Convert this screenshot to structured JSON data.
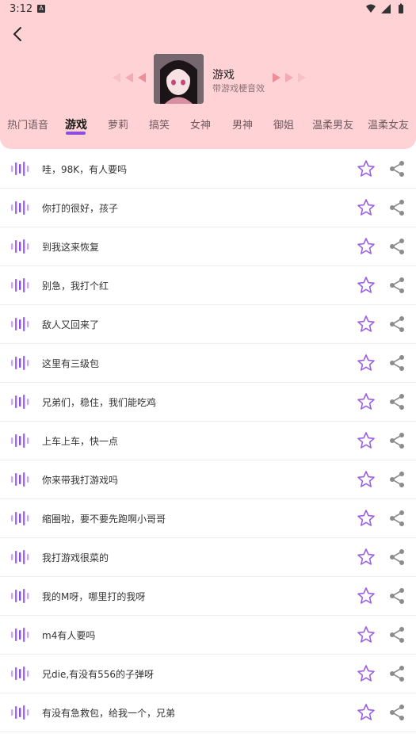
{
  "status": {
    "time": "3:12"
  },
  "category": {
    "title": "游戏",
    "subtitle": "带游戏梗音效"
  },
  "tabs": [
    {
      "label": "热门语音",
      "active": false
    },
    {
      "label": "游戏",
      "active": true
    },
    {
      "label": "萝莉",
      "active": false
    },
    {
      "label": "搞笑",
      "active": false
    },
    {
      "label": "女神",
      "active": false
    },
    {
      "label": "男神",
      "active": false
    },
    {
      "label": "御姐",
      "active": false
    },
    {
      "label": "温柔男友",
      "active": false
    },
    {
      "label": "温柔女友",
      "active": false
    }
  ],
  "items": [
    {
      "text": "哇，98K，有人要吗"
    },
    {
      "text": "你打的很好，孩子"
    },
    {
      "text": "到我这来恢复"
    },
    {
      "text": "别急，我打个红"
    },
    {
      "text": "敌人又回来了"
    },
    {
      "text": "这里有三级包"
    },
    {
      "text": "兄弟们，稳住，我们能吃鸡"
    },
    {
      "text": "上车上车，快一点"
    },
    {
      "text": "你来带我打游戏吗"
    },
    {
      "text": "缩圈啦，要不要先跑啊小哥哥"
    },
    {
      "text": "我打游戏很菜的"
    },
    {
      "text": "我的M呀，哪里打的我呀"
    },
    {
      "text": "m4有人要吗"
    },
    {
      "text": "兄die,有没有556的子弹呀"
    },
    {
      "text": "有没有急救包，给我一个，兄弟"
    }
  ],
  "colors": {
    "header_bg": "#ffd3d6",
    "accent": "#8a4fe0",
    "icon_gray": "#8c8c8c"
  }
}
